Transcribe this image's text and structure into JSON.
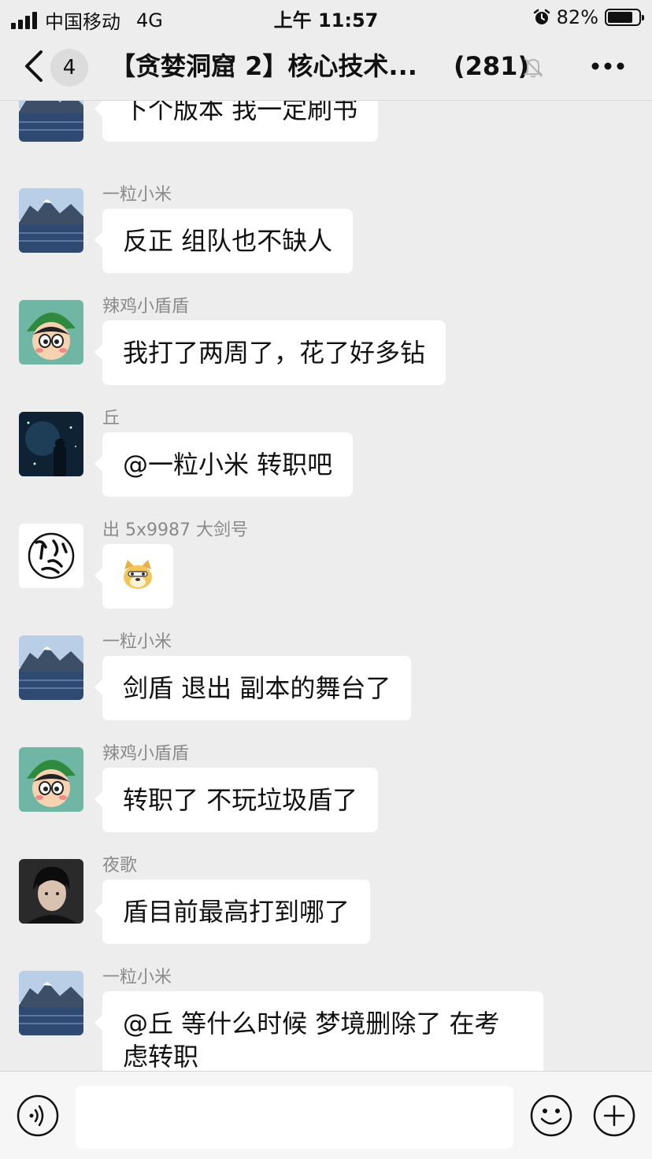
{
  "status_bar": {
    "carrier": "中国移动",
    "network": "4G",
    "time": "上午 11:57",
    "battery": "82%",
    "battery_level": 0.82,
    "signal_bars": 4
  },
  "header": {
    "unread_count": "4",
    "title": "【贪婪洞窟 2】核心技术...",
    "member_count": "(281)"
  },
  "messages": [
    {
      "sender": "",
      "text": "下个版本 我一定刷书",
      "avatar": "mountain-lake"
    },
    {
      "sender": "一粒小米",
      "text": "反正 组队也不缺人",
      "avatar": "mountain-lake"
    },
    {
      "sender": "辣鸡小盾盾",
      "text": "我打了两周了，花了好多钻",
      "avatar": "cartoon-boy"
    },
    {
      "sender": "丘",
      "text": "@一粒小米 转职吧",
      "avatar": "starry-night"
    },
    {
      "sender": "出 5x9987 大剑号",
      "text": "",
      "sticker": "doge-emoji",
      "avatar": "calligraphy-seal"
    },
    {
      "sender": "一粒小米",
      "text": "剑盾 退出 副本的舞台了",
      "avatar": "mountain-lake"
    },
    {
      "sender": "辣鸡小盾盾",
      "text": "转职了 不玩垃圾盾了",
      "avatar": "cartoon-boy"
    },
    {
      "sender": "夜歌",
      "text": "盾目前最高打到哪了",
      "avatar": "portrait"
    },
    {
      "sender": "一粒小米",
      "text": "@丘 等什么时候 梦境删除了 在考虑转职",
      "avatar": "mountain-lake"
    }
  ],
  "colors": {
    "background": "#ededed",
    "bubble": "#ffffff",
    "sender_name": "#8a8a8a",
    "input_bar": "#f6f6f6"
  }
}
